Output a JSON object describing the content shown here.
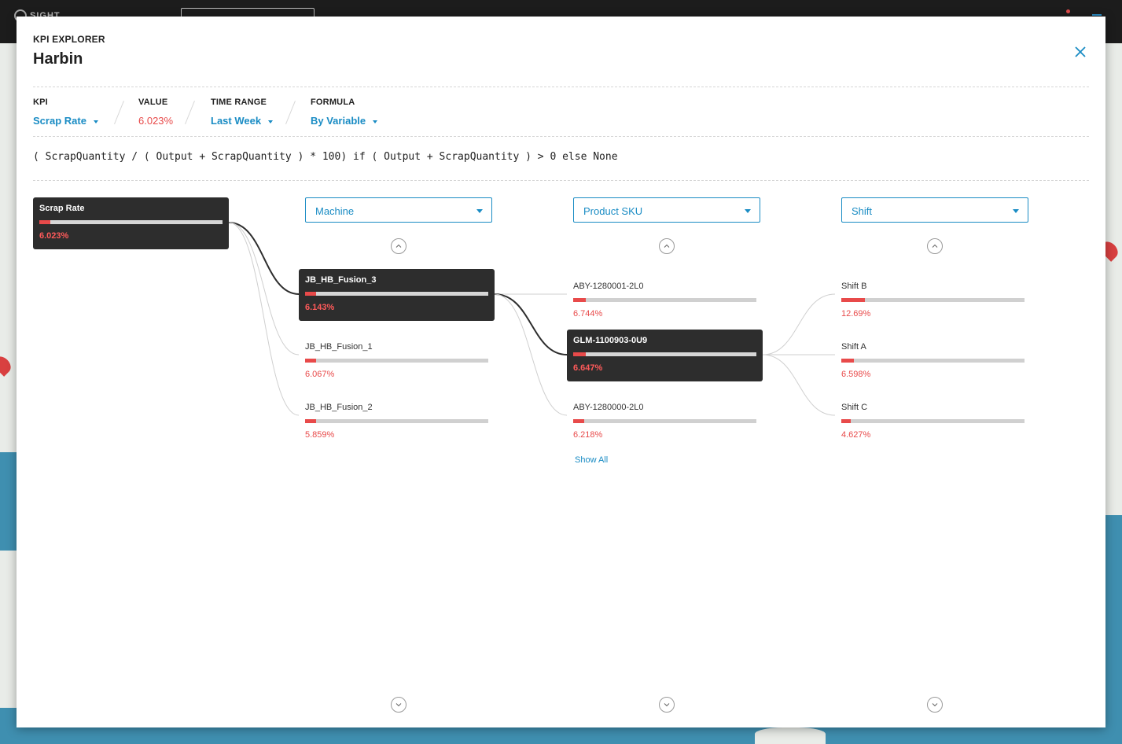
{
  "background": {
    "app_logo": "SIGHT"
  },
  "modal": {
    "eyebrow": "KPI EXPLORER",
    "title": "Harbin"
  },
  "controls": {
    "kpi": {
      "label": "KPI",
      "value": "Scrap Rate"
    },
    "value": {
      "label": "VALUE",
      "value": "6.023%"
    },
    "time_range": {
      "label": "TIME RANGE",
      "value": "Last Week"
    },
    "formula_mode": {
      "label": "FORMULA",
      "value": "By Variable"
    }
  },
  "formula": "( ScrapQuantity / ( Output + ScrapQuantity ) * 100) if ( Output + ScrapQuantity ) > 0 else None",
  "root": {
    "name": "Scrap Rate",
    "value": "6.023%",
    "level": 0.06
  },
  "columns": [
    {
      "dimension": "Machine",
      "items": [
        {
          "name": "JB_HB_Fusion_3",
          "value": "6.143%",
          "level": 0.06,
          "selected": true
        },
        {
          "name": "JB_HB_Fusion_1",
          "value": "6.067%",
          "level": 0.06,
          "selected": false
        },
        {
          "name": "JB_HB_Fusion_2",
          "value": "5.859%",
          "level": 0.06,
          "selected": false
        }
      ]
    },
    {
      "dimension": "Product SKU",
      "items": [
        {
          "name": "ABY-1280001-2L0",
          "value": "6.744%",
          "level": 0.07,
          "selected": false
        },
        {
          "name": "GLM-1100903-0U9",
          "value": "6.647%",
          "level": 0.07,
          "selected": true
        },
        {
          "name": "ABY-1280000-2L0",
          "value": "6.218%",
          "level": 0.06,
          "selected": false
        }
      ],
      "show_all": "Show All"
    },
    {
      "dimension": "Shift",
      "items": [
        {
          "name": "Shift B",
          "value": "12.69%",
          "level": 0.13,
          "selected": false
        },
        {
          "name": "Shift A",
          "value": "6.598%",
          "level": 0.07,
          "selected": false
        },
        {
          "name": "Shift C",
          "value": "4.627%",
          "level": 0.05,
          "selected": false
        }
      ]
    }
  ],
  "colors": {
    "accent": "#1a8cc4",
    "alert": "#e84a4a",
    "node_dark": "#2d2d2d"
  },
  "icons": {
    "close": "close-icon",
    "scroll_up": "chevron-up-icon",
    "scroll_down": "chevron-down-icon",
    "dropdown": "caret-down-icon"
  }
}
